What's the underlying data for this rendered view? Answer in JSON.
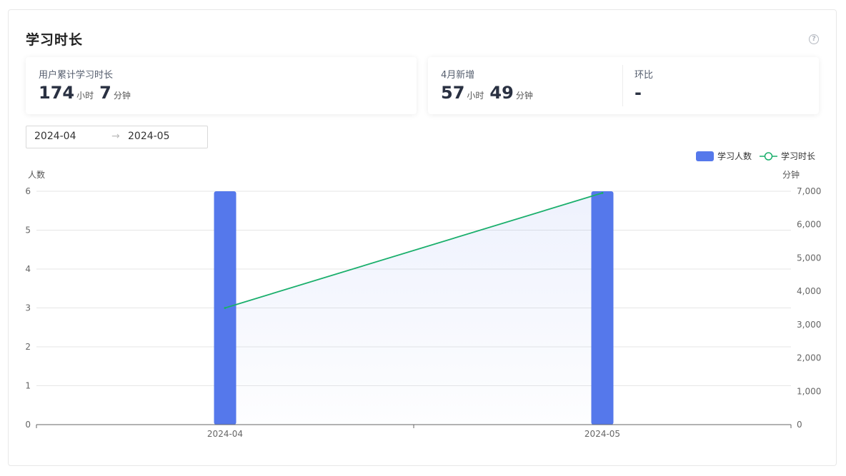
{
  "panel": {
    "title": "学习时长",
    "help_icon": "question-circle-icon",
    "help_glyph": "?"
  },
  "cards": {
    "total": {
      "label": "用户累计学习时长",
      "hours": "174",
      "hours_unit": "小时",
      "minutes": "7",
      "minutes_unit": "分钟"
    },
    "monthly": {
      "label": "4月新增",
      "hours": "57",
      "hours_unit": "小时",
      "minutes": "49",
      "minutes_unit": "分钟"
    },
    "ratio": {
      "label": "环比",
      "value": "-"
    }
  },
  "date_range": {
    "start": "2024-04",
    "separator": "→",
    "end": "2024-05"
  },
  "chart_data": {
    "type": "bar",
    "categories": [
      "2024-04",
      "2024-05"
    ],
    "series": [
      {
        "name": "学习人数",
        "type": "bar",
        "axis": "left",
        "values": [
          6,
          6
        ],
        "color": "#5578eb"
      },
      {
        "name": "学习时长",
        "type": "line",
        "axis": "right",
        "values": [
          3500,
          6950
        ],
        "color": "#1aaf6c",
        "area": true
      }
    ],
    "ylabel_left": "人数",
    "ylabel_right": "分钟",
    "ylim_left": [
      0,
      6
    ],
    "ylim_right": [
      0,
      7000
    ],
    "yticks_left": [
      "0",
      "1",
      "2",
      "3",
      "4",
      "5",
      "6"
    ],
    "yticks_right": [
      "0",
      "1,000",
      "2,000",
      "3,000",
      "4,000",
      "5,000",
      "6,000",
      "7,000"
    ],
    "legend_position": "top-right",
    "grid": true
  }
}
